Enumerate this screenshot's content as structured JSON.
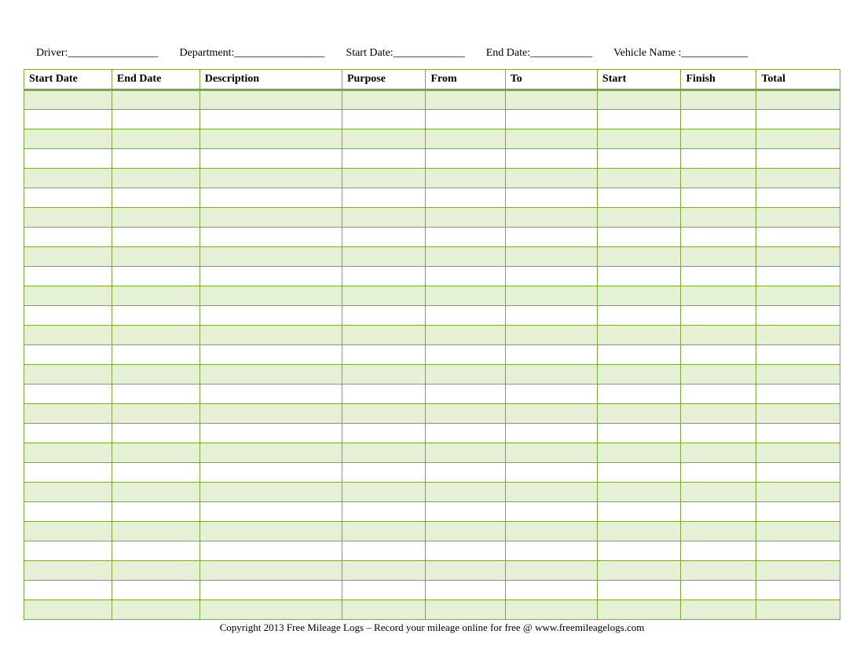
{
  "header": {
    "driver_label": "Driver:",
    "driver_blank": "___________________",
    "department_label": "Department:",
    "department_blank": "___________________",
    "startdate_label": "Start Date:",
    "startdate_blank": "_______________",
    "enddate_label": "End Date:",
    "enddate_blank": "_____________",
    "vehicle_label": "Vehicle Name :",
    "vehicle_blank": "______________"
  },
  "columns": {
    "start_date": "Start Date",
    "end_date": "End Date",
    "description": "Description",
    "purpose": "Purpose",
    "from": "From",
    "to": "To",
    "start": "Start",
    "finish": "Finish",
    "total": "Total"
  },
  "row_count": 27,
  "footer": "Copyright 2013 Free Mileage Logs – Record your mileage online for free @ www.freemileagelogs.com"
}
